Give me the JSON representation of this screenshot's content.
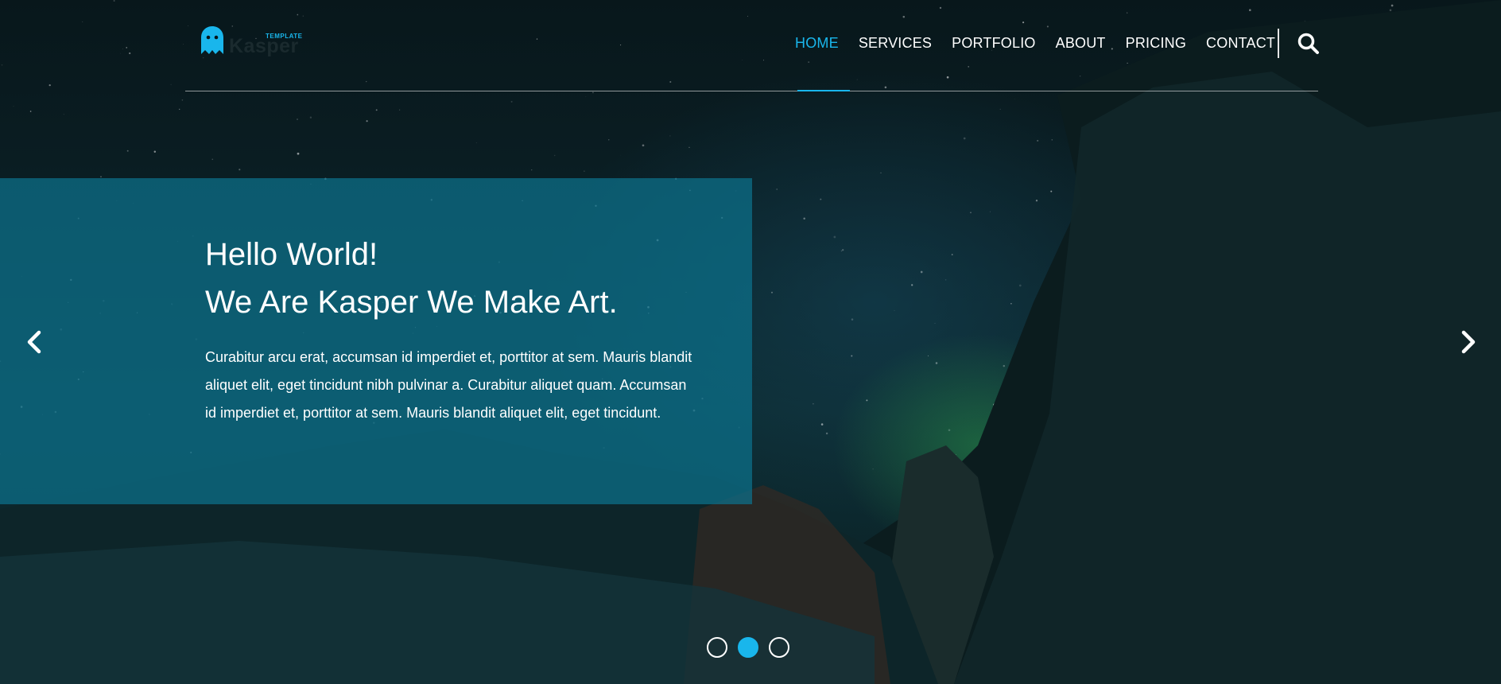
{
  "brand": {
    "name": "Kasper",
    "tagline": "TEMPLATE",
    "accent_color": "#19b6ec",
    "logo_icon": "ghost-icon"
  },
  "nav": {
    "items": [
      {
        "label": "HOME",
        "active": true
      },
      {
        "label": "SERVICES",
        "active": false
      },
      {
        "label": "PORTFOLIO",
        "active": false
      },
      {
        "label": "ABOUT",
        "active": false
      },
      {
        "label": "PRICING",
        "active": false
      },
      {
        "label": "CONTACT",
        "active": false
      }
    ],
    "search_icon": "search-icon"
  },
  "slide": {
    "title_line1": "Hello World!",
    "title_line2": "We Are Kasper We Make Art.",
    "text": "Curabitur arcu erat, accumsan id imperdiet et, porttitor at sem. Mauris blandit aliquet elit, eget tincidunt nibh pulvinar a. Curabitur aliquet quam. Accumsan id imperdiet et, porttitor at sem. Mauris blandit aliquet elit, eget tincidunt.",
    "prev_icon": "chevron-left-icon",
    "next_icon": "chevron-right-icon"
  },
  "pagination": {
    "count": 3,
    "active_index": 1
  }
}
